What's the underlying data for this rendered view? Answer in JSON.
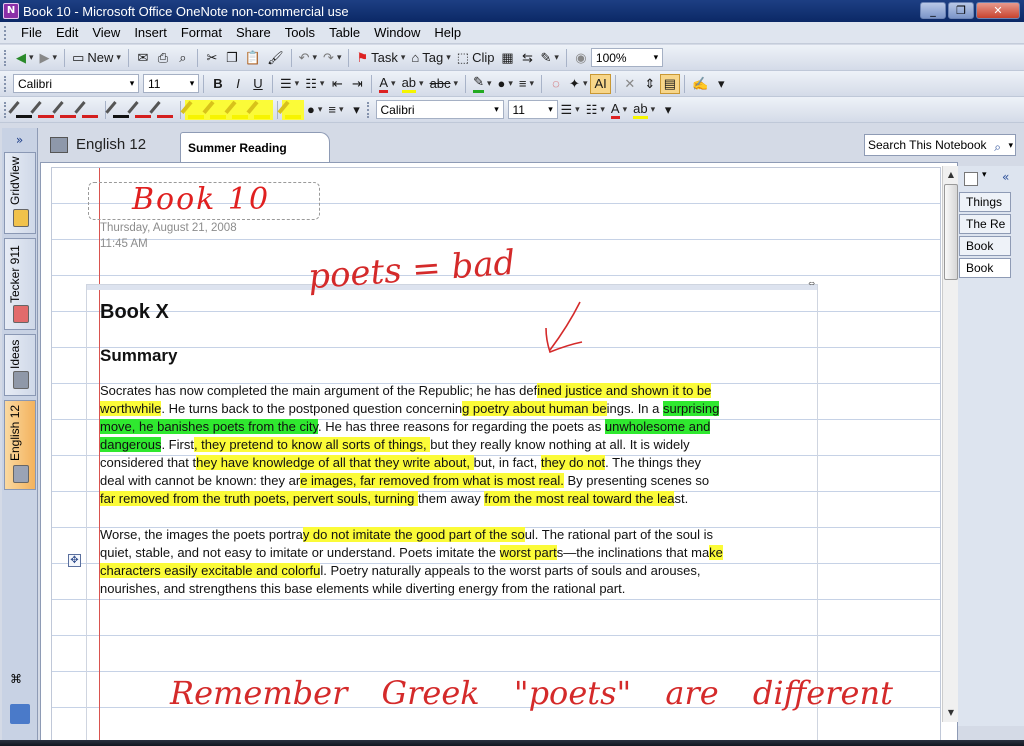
{
  "window": {
    "title": "Book 10 - Microsoft Office OneNote non-commercial use"
  },
  "menu": [
    "File",
    "Edit",
    "View",
    "Insert",
    "Format",
    "Share",
    "Tools",
    "Table",
    "Window",
    "Help"
  ],
  "toolbar1": {
    "new_label": "New",
    "task_label": "Task",
    "tag_label": "Tag",
    "clip_label": "Clip",
    "zoom": "100%"
  },
  "toolbar2": {
    "font": "Calibri",
    "size": "11"
  },
  "toolbar3": {
    "font": "Calibri",
    "size": "11"
  },
  "leftnav": {
    "collapse": "»",
    "notebooks": [
      "GridView",
      "Tecker 911",
      "Ideas",
      "English 12"
    ],
    "active": "English 12"
  },
  "notebook": {
    "name": "English 12",
    "section": "Summer Reading"
  },
  "search": {
    "placeholder": "Search This Notebook"
  },
  "pagetabs": [
    "Things",
    "The Re",
    "Book",
    "Book"
  ],
  "page": {
    "title_ink": "Book 10",
    "date": "Thursday, August 21, 2008",
    "time": "11:45 AM",
    "heading": "Book X",
    "subheading": "Summary",
    "ink_note1": "poets = bad",
    "ink_note2": "Remember Greek \"poets\" are different",
    "para1": [
      {
        "t": "Socrates has now completed the main argument of the Republic; he has def",
        "h": ""
      },
      {
        "t": "ined justice and shown it to be worthwhile",
        "h": "y"
      },
      {
        "t": ". He turns back to the postponed question concernin",
        "h": ""
      },
      {
        "t": "g poetry about human be",
        "h": "y"
      },
      {
        "t": "ings. In a ",
        "h": ""
      },
      {
        "t": "surprising move, he ban",
        "h": "g"
      },
      {
        "t": "ishes poets from the city",
        "h": "g"
      },
      {
        "t": ". He has three reasons for regarding the poets as ",
        "h": ""
      },
      {
        "t": "unwholesome and dangerous",
        "h": "g"
      },
      {
        "t": ". First",
        "h": ""
      },
      {
        "t": ", they pretend to know all sorts of things, ",
        "h": "y"
      },
      {
        "t": "but they really know nothing at all. It is widely considered that t",
        "h": ""
      },
      {
        "t": "hey have knowledge of all that they write about, ",
        "h": "y"
      },
      {
        "t": "but, in fact, ",
        "h": ""
      },
      {
        "t": "they do not",
        "h": "y"
      },
      {
        "t": ". The things they deal with cannot be known: they ar",
        "h": ""
      },
      {
        "t": "e images, far removed from what is most real.",
        "h": "y"
      },
      {
        "t": " By presenting scenes so ",
        "h": ""
      },
      {
        "t": "far removed from the truth poets, pervert souls, turning ",
        "h": "y"
      },
      {
        "t": "them away ",
        "h": ""
      },
      {
        "t": "from the most real toward the lea",
        "h": "y"
      },
      {
        "t": "st.",
        "h": ""
      }
    ],
    "para2": [
      {
        "t": "Worse, the images the poets portra",
        "h": ""
      },
      {
        "t": "y do not imitate the good part of the so",
        "h": "y"
      },
      {
        "t": "ul. The rational part of the soul is quiet, stable, and not easy to imitate or understand. Poets imitate the ",
        "h": ""
      },
      {
        "t": "worst part",
        "h": "y"
      },
      {
        "t": "s—the inclinations that ma",
        "h": ""
      },
      {
        "t": "ke characters easily excitable and colorfu",
        "h": "y"
      },
      {
        "t": "l. Poetry naturally appeals to the worst parts of souls and arouses, nourishes, and strengthens this base elements while diverting energy from the rational part.",
        "h": ""
      }
    ]
  }
}
